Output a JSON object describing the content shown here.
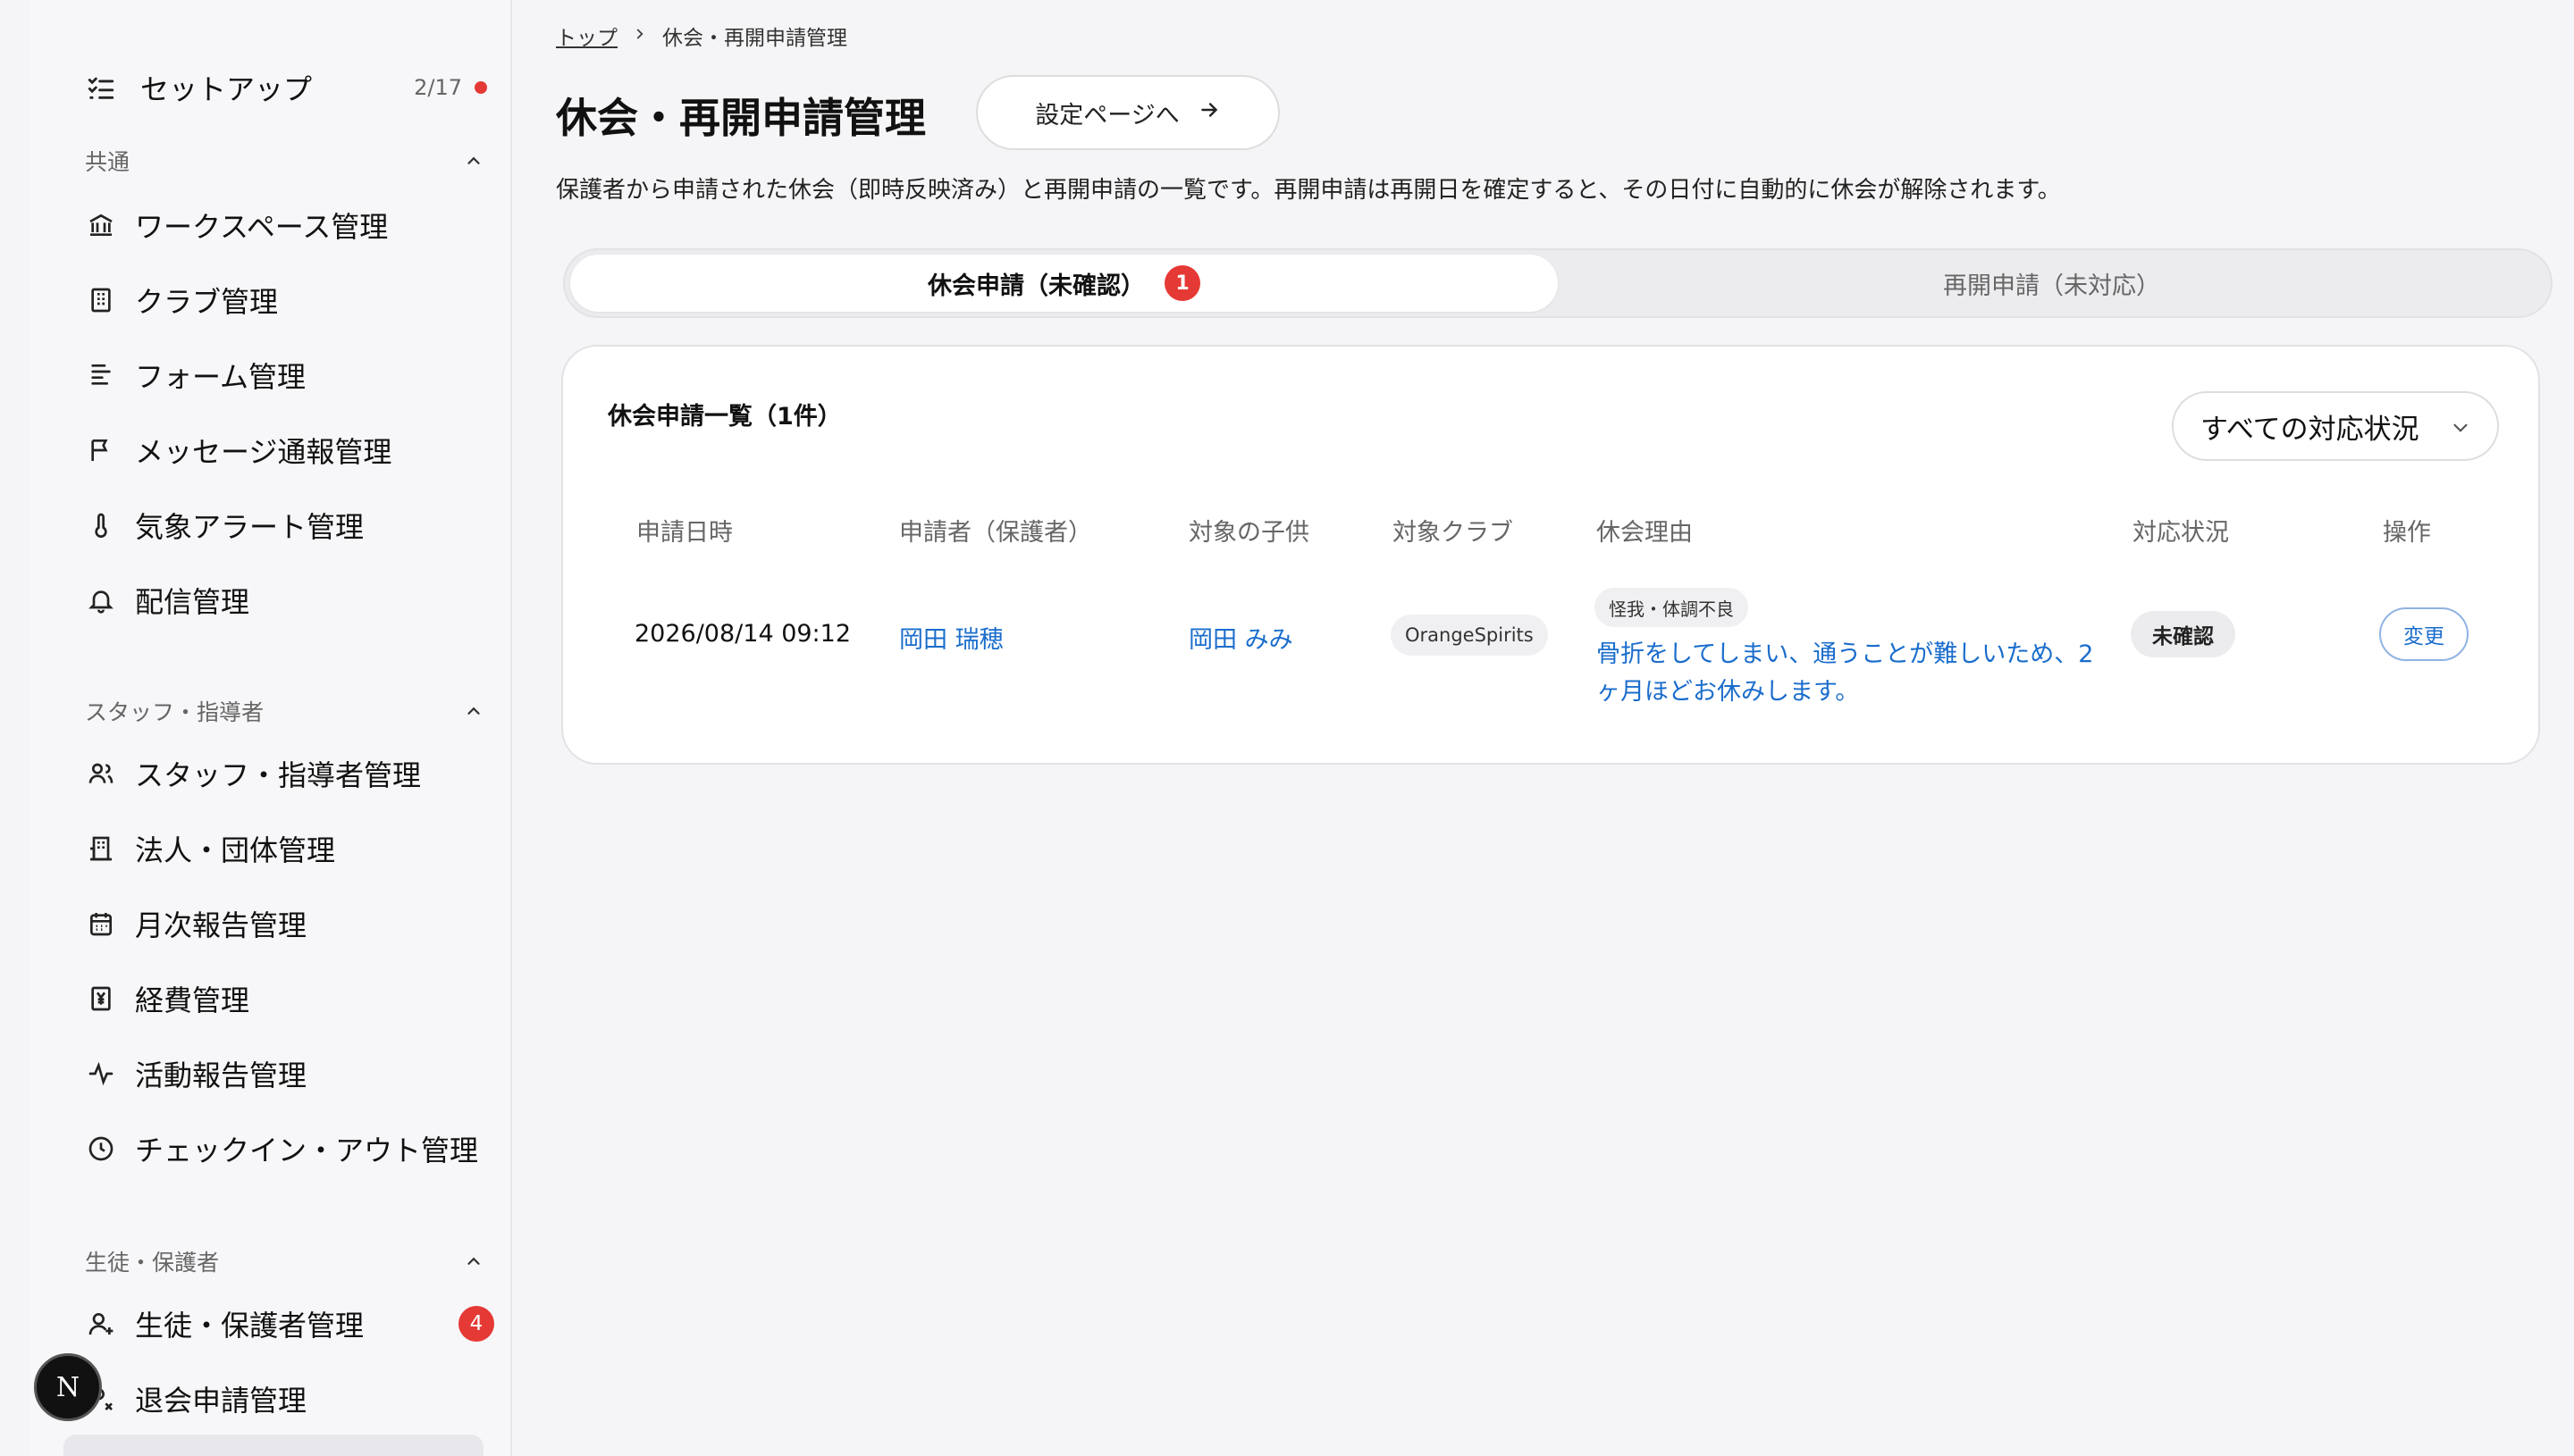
{
  "sidebar": {
    "setup": {
      "label": "セットアップ",
      "count": "2/17",
      "icon": "checklist-icon"
    },
    "sections": [
      {
        "title": "共通",
        "items": [
          {
            "label": "ワークスペース管理",
            "icon": "bank-icon"
          },
          {
            "label": "クラブ管理",
            "icon": "building-icon"
          },
          {
            "label": "フォーム管理",
            "icon": "form-icon"
          },
          {
            "label": "メッセージ通報管理",
            "icon": "flag-icon"
          },
          {
            "label": "気象アラート管理",
            "icon": "thermometer-icon"
          },
          {
            "label": "配信管理",
            "icon": "bell-icon"
          }
        ]
      },
      {
        "title": "スタッフ・指導者",
        "items": [
          {
            "label": "スタッフ・指導者管理",
            "icon": "users-icon"
          },
          {
            "label": "法人・団体管理",
            "icon": "office-icon"
          },
          {
            "label": "月次報告管理",
            "icon": "calendar-icon"
          },
          {
            "label": "経費管理",
            "icon": "yen-receipt-icon"
          },
          {
            "label": "活動報告管理",
            "icon": "activity-icon"
          },
          {
            "label": "チェックイン・アウト管理",
            "icon": "clock-icon"
          }
        ]
      },
      {
        "title": "生徒・保護者",
        "items": [
          {
            "label": "生徒・保護者管理",
            "icon": "user-plus-icon",
            "badge": "4"
          },
          {
            "label": "退会申請管理",
            "icon": "user-x-icon"
          }
        ]
      }
    ],
    "fab_label": "N"
  },
  "breadcrumb": {
    "home": "トップ",
    "current": "休会・再開申請管理"
  },
  "page": {
    "title": "休会・再開申請管理",
    "settings_button": "設定ページへ",
    "description": "保護者から申請された休会（即時反映済み）と再開申請の一覧です。再開申請は再開日を確定すると、その日付に自動的に休会が解除されます。"
  },
  "tabs": [
    {
      "label": "休会申請（未確認）",
      "badge": "1",
      "active": true
    },
    {
      "label": "再開申請（未対応）",
      "active": false
    }
  ],
  "list": {
    "title": "休会申請一覧（1件）",
    "filter_value": "すべての対応状況",
    "columns": [
      "申請日時",
      "申請者（保護者）",
      "対象の子供",
      "対象クラブ",
      "休会理由",
      "対応状況",
      "操作"
    ],
    "rows": [
      {
        "date": "2026/08/14 09:12",
        "applicant": "岡田 瑞穂",
        "child": "岡田 みみ",
        "club": "OrangeSpirits",
        "reason_tag": "怪我・体調不良",
        "reason_text": "骨折をしてしまい、通うことが難しいため、2ヶ月ほどお休みします。",
        "status": "未確認",
        "action": "変更"
      }
    ]
  },
  "colors": {
    "accent": "#1a6dcc",
    "badge": "#e53935"
  }
}
